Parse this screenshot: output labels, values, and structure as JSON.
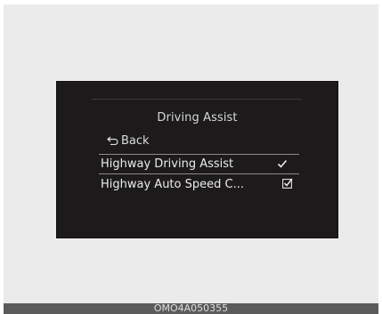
{
  "screen": {
    "title": "Driving Assist",
    "back_label": "Back",
    "menu_items": [
      {
        "label": "Highway Driving Assist",
        "checked": true,
        "highlighted": true
      },
      {
        "label": "Highway Auto Speed C...",
        "checked": true,
        "highlighted": false
      }
    ],
    "icons": {
      "back": "back-arrow-icon",
      "check": "check-icon",
      "checkbox": "checkbox-checked-icon"
    }
  },
  "caption": "OMO4A050355",
  "colors": {
    "screen_bg": "#1c1a1b",
    "frame_bg": "#ebebeb",
    "caption_bar": "#5b5b5b"
  }
}
